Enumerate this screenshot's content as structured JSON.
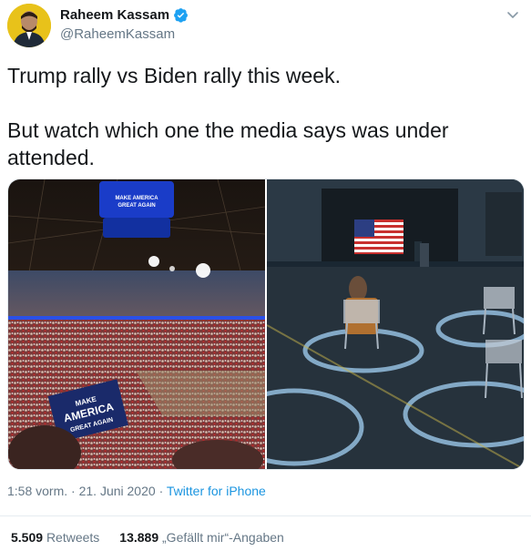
{
  "author": {
    "display_name": "Raheem Kassam",
    "handle": "@RaheemKassam",
    "verified": true,
    "avatar_icon": "avatar-photo"
  },
  "tweet": {
    "text": "Trump rally vs Biden rally this week.\n\nBut watch which one the media says was under attended.",
    "images": [
      {
        "alt": "Trump rally",
        "icon": "crowd-arena-photo",
        "sign_text": "MAKE AMERICA GREAT AGAIN"
      },
      {
        "alt": "Biden rally",
        "icon": "empty-hall-photo"
      }
    ]
  },
  "meta": {
    "time": "1:58 vorm.",
    "separator": "·",
    "date": "21. Juni 2020",
    "source": "Twitter for iPhone"
  },
  "stats": {
    "retweets_count": "5.509",
    "retweets_label": "Retweets",
    "likes_count": "13.889",
    "likes_label": "„Gefällt mir“-Angaben"
  },
  "colors": {
    "link": "#1b95e0",
    "muted": "#657786",
    "verified": "#1da1f2"
  }
}
